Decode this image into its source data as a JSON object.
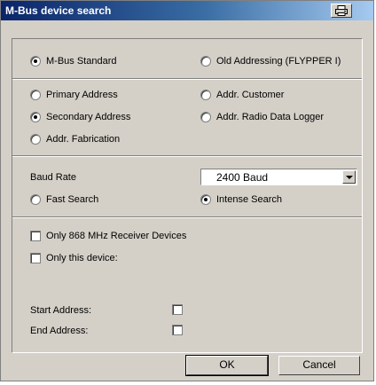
{
  "window": {
    "title": "M-Bus device search"
  },
  "addressing": {
    "mbus_standard": {
      "label": "M-Bus Standard",
      "checked": true
    },
    "old_addressing": {
      "label": "Old Addressing (FLYPPER I)",
      "checked": false
    }
  },
  "address_type": {
    "primary": {
      "label": "Primary Address",
      "checked": false
    },
    "customer": {
      "label": "Addr. Customer",
      "checked": false
    },
    "secondary": {
      "label": "Secondary Address",
      "checked": true
    },
    "radio_logger": {
      "label": "Addr. Radio Data Logger",
      "checked": false
    },
    "fabrication": {
      "label": "Addr. Fabrication",
      "checked": false
    }
  },
  "search": {
    "baud_label": "Baud Rate",
    "baud_value": "2400 Baud",
    "fast": {
      "label": "Fast Search",
      "checked": false
    },
    "intense": {
      "label": "Intense Search",
      "checked": true
    }
  },
  "filters": {
    "only_868": {
      "label": "Only 868 MHz Receiver Devices",
      "checked": false
    },
    "only_this": {
      "label": "Only this device:",
      "checked": false
    }
  },
  "range": {
    "start_label": "Start Address:",
    "end_label": "End Address:"
  },
  "buttons": {
    "ok": "OK",
    "cancel": "Cancel"
  },
  "icons": {
    "title_button": "printer-icon"
  },
  "colors": {
    "titlebar_start": "#0a246a",
    "titlebar_end": "#a6caf0",
    "dialog_bg": "#d4d0c8"
  }
}
